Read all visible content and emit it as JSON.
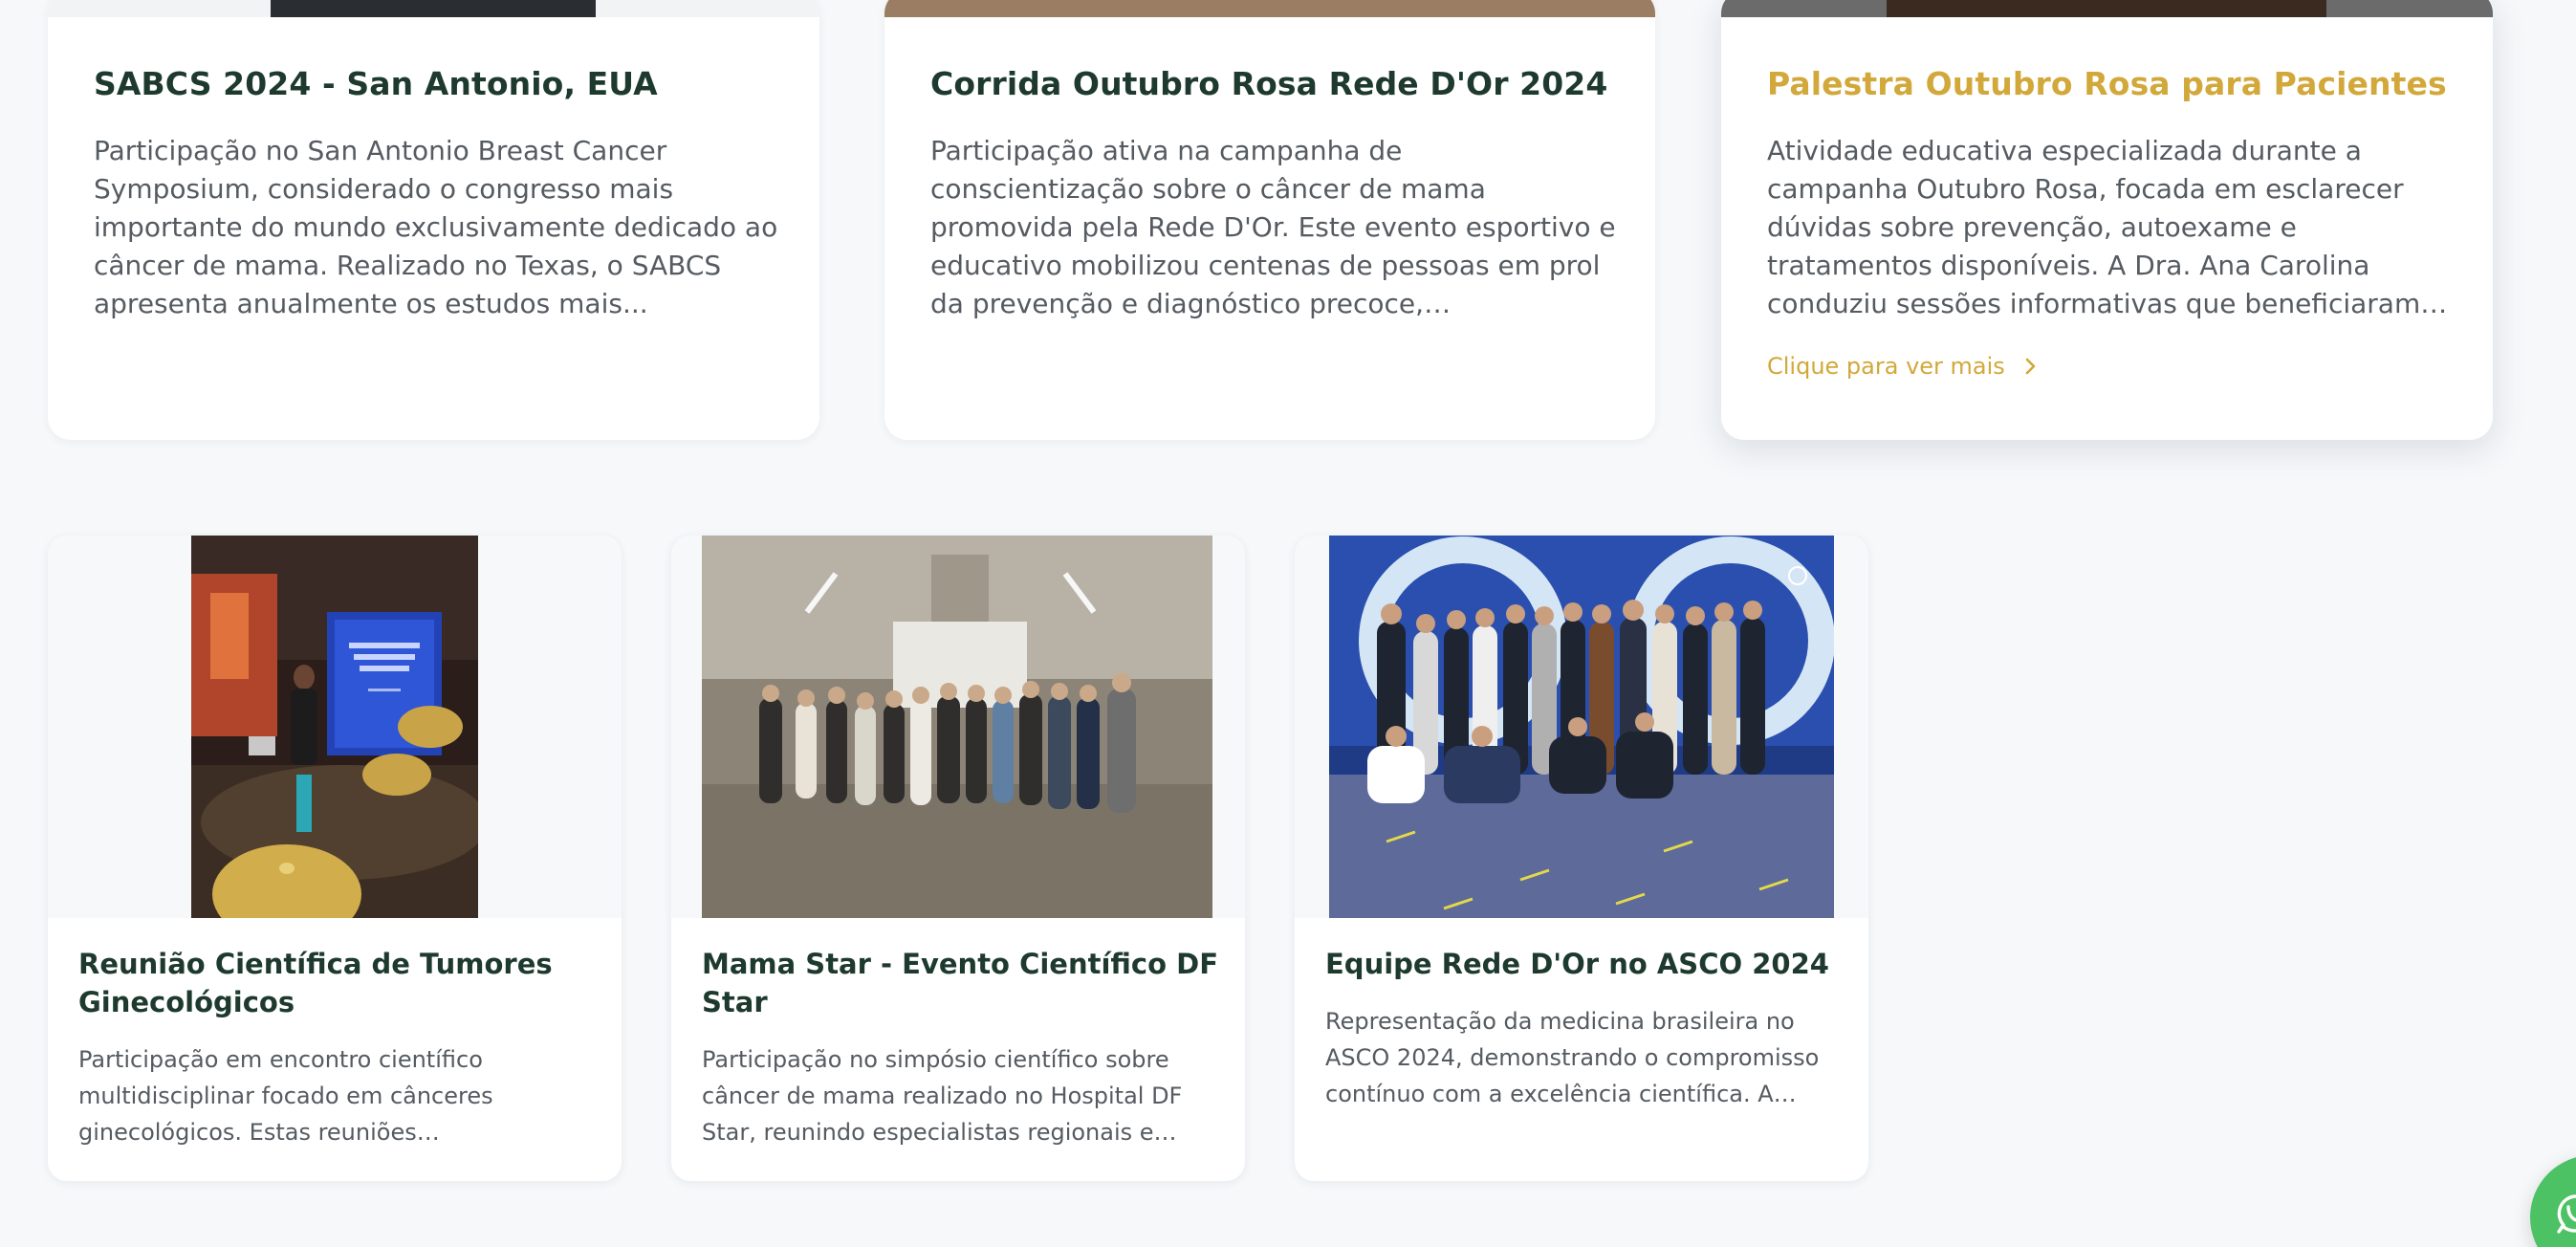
{
  "top_cards": [
    {
      "title": "SABCS 2024 - San Antonio, EUA",
      "description": "Participação no San Antonio Breast Cancer Symposium, considerado o congresso mais importante do mundo exclusivamente dedicado ao câncer de mama. Realizado no Texas, o SABCS apresenta anualmente os estudos mais..."
    },
    {
      "title": "Corrida Outubro Rosa Rede D'Or 2024",
      "description": "Participação ativa na campanha de conscientização sobre o câncer de mama promovida pela Rede D'Or. Este evento esportivo e educativo mobilizou centenas de pessoas em prol da prevenção e diagnóstico precoce, demonstrando o engajamento da Dra. Ana..."
    },
    {
      "title": "Palestra Outubro Rosa para Pacientes",
      "description": "Atividade educativa especializada durante a campanha Outubro Rosa, focada em esclarecer dúvidas sobre prevenção, autoexame e tratamentos disponíveis. A Dra. Ana Carolina conduziu sessões informativas que beneficiaram dezenas de mulheres...",
      "link_label": "Clique para ver mais"
    }
  ],
  "event_cards": [
    {
      "title": "Reunião Científica de Tumores Ginecológicos",
      "description": "Participação em encontro científico multidisciplinar focado em cânceres ginecológicos. Estas reuniões especializadas..."
    },
    {
      "title": "Mama Star - Evento Científico DF Star",
      "description": "Participação no simpósio científico sobre câncer de mama realizado no Hospital DF Star, reunindo especialistas regionais e nacionais...."
    },
    {
      "title": "Equipe Rede D'Or no ASCO 2024",
      "description": "Representação da medicina brasileira no ASCO 2024, demonstrando o compromisso contínuo com a excelência científica. A participação anu..."
    }
  ],
  "colors": {
    "heading": "#1e3a2f",
    "accent_gold": "#d2a83a",
    "body_text": "#555b61",
    "whatsapp_green": "#4cc265",
    "page_bg": "#f6f8fa"
  },
  "icons": {
    "more_link": "chevron-right-icon",
    "floating_button": "whatsapp-icon"
  }
}
